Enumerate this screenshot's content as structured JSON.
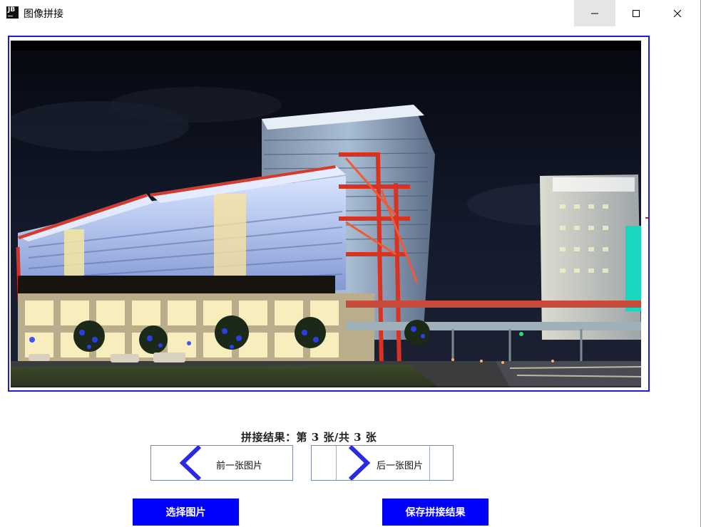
{
  "window": {
    "title": "图像拼接",
    "app_icon_text": "JB",
    "controls": [
      "minimize-icon",
      "maximize-icon",
      "close-icon"
    ]
  },
  "viewer": {
    "photo_description_icon": "stitched-panorama-image",
    "frame_color": "#1a1ae0"
  },
  "result": {
    "label": "拼接结果：第 3 张/共 3 张",
    "current": 3,
    "total": 3
  },
  "navigation": {
    "prev_label": "前一张图片",
    "prev_icon": "chevron-left-icon",
    "next_label": "后一张图片",
    "next_icon": "chevron-right-icon",
    "chevron_color": "#2a2ae0"
  },
  "actions": {
    "select_label": "选择图片",
    "save_label": "保存拼接结果",
    "button_color": "#0000ff"
  }
}
